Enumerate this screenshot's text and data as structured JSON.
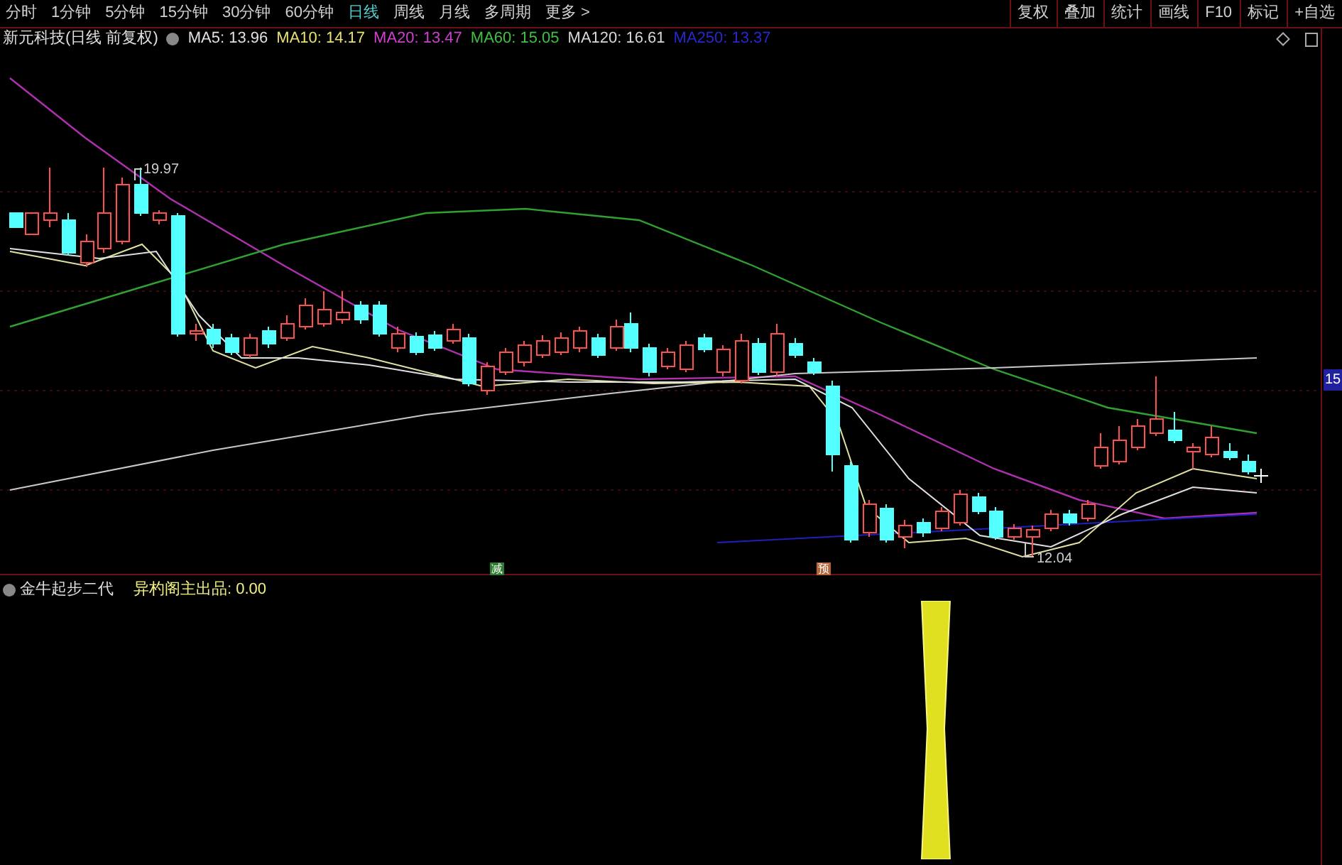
{
  "toolbar": {
    "periods": [
      {
        "label": "分时",
        "selected": false
      },
      {
        "label": "1分钟",
        "selected": false
      },
      {
        "label": "5分钟",
        "selected": false
      },
      {
        "label": "15分钟",
        "selected": false
      },
      {
        "label": "30分钟",
        "selected": false
      },
      {
        "label": "60分钟",
        "selected": false
      },
      {
        "label": "日线",
        "selected": true
      },
      {
        "label": "周线",
        "selected": false
      },
      {
        "label": "月线",
        "selected": false
      },
      {
        "label": "多周期",
        "selected": false
      },
      {
        "label": "更多 >",
        "selected": false
      }
    ],
    "buttons": [
      "复权",
      "叠加",
      "统计",
      "画线",
      "F10",
      "标记",
      "+自选"
    ]
  },
  "main_pane": {
    "title": "新元科技(日线 前复权)",
    "ma_legend": [
      {
        "label": "MA5: 13.96",
        "color": "#e0e0e0"
      },
      {
        "label": "MA10: 14.17",
        "color": "#e8e070"
      },
      {
        "label": "MA20: 13.47",
        "color": "#d040d0"
      },
      {
        "label": "MA60: 15.05",
        "color": "#40c040"
      },
      {
        "label": "MA120: 16.61",
        "color": "#d8d8d8"
      },
      {
        "label": "MA250: 13.37",
        "color": "#2828d0"
      }
    ],
    "price_labels": [
      "19.97",
      "12.04"
    ],
    "axis_label": "15",
    "signals": [
      {
        "text": "减",
        "color": "#2e7d32"
      },
      {
        "text": "预",
        "color": "#b5653a"
      }
    ]
  },
  "indicator_pane": {
    "title": "金牛起步二代",
    "value": "异杓阁主出品: 0.00"
  }
}
